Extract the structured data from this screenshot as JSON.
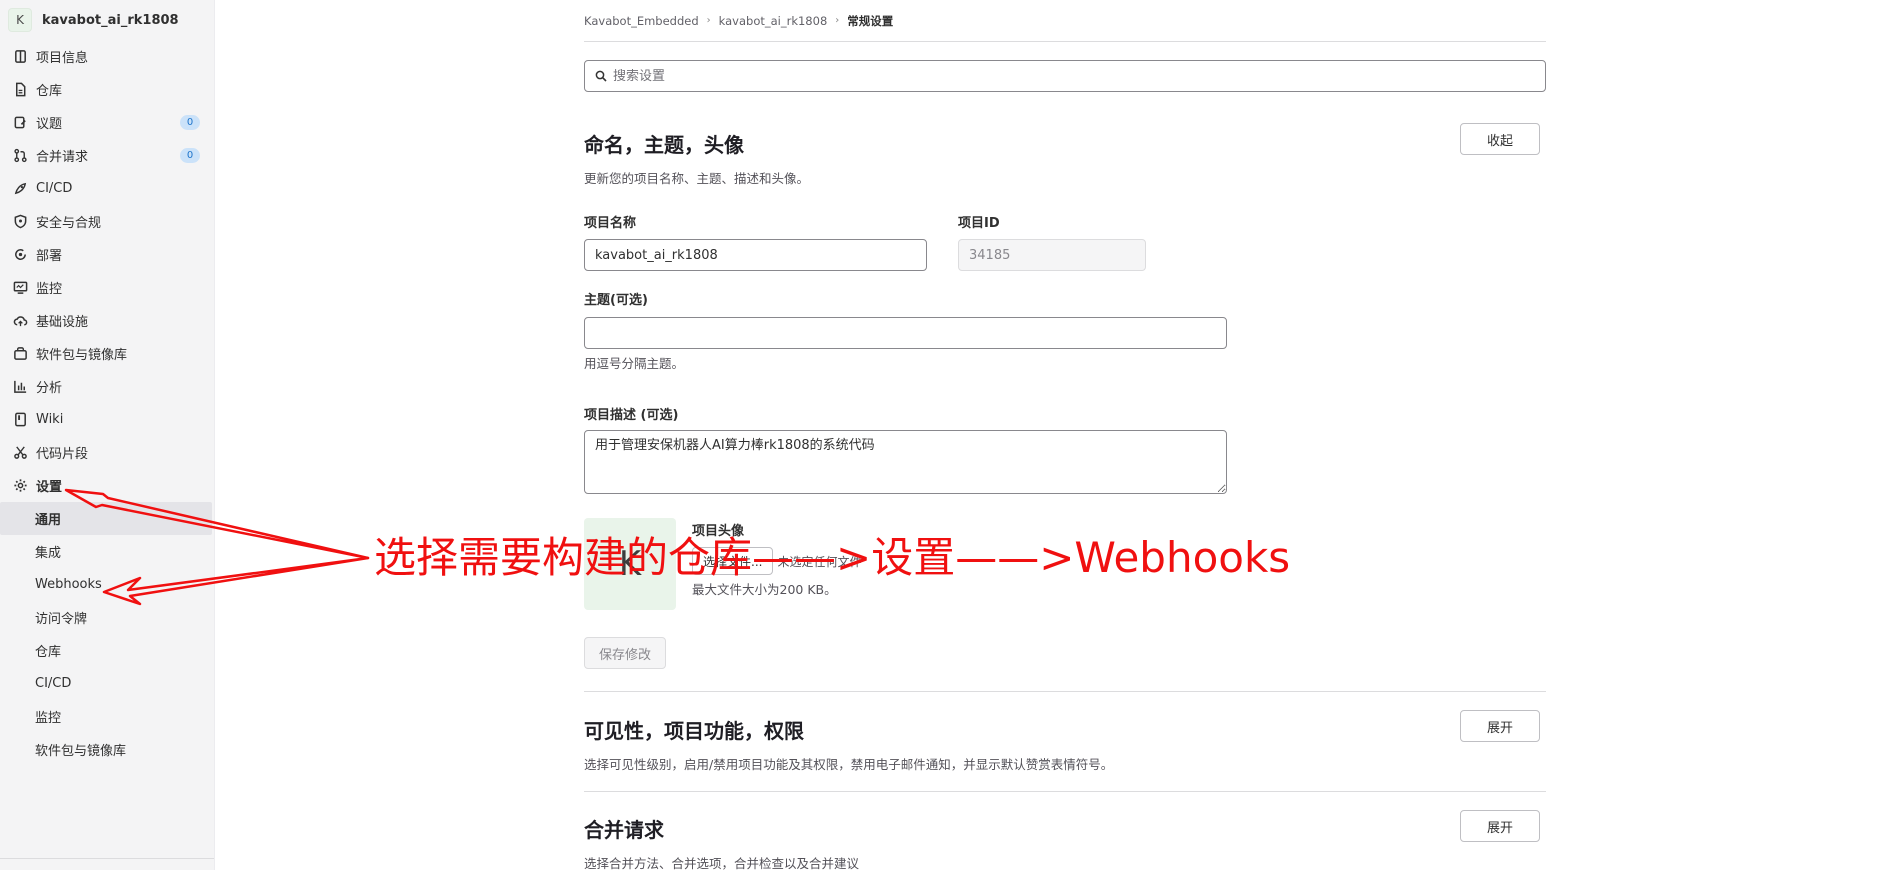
{
  "sidebar": {
    "project_initial": "K",
    "project_name": "kavabot_ai_rk1808",
    "items": [
      {
        "label": "项目信息",
        "icon": "project-icon"
      },
      {
        "label": "仓库",
        "icon": "doc-icon"
      },
      {
        "label": "议题",
        "icon": "issues-icon",
        "badge": "0"
      },
      {
        "label": "合并请求",
        "icon": "merge-request-icon",
        "badge": "0"
      },
      {
        "label": "CI/CD",
        "icon": "rocket-icon"
      },
      {
        "label": "安全与合规",
        "icon": "shield-icon"
      },
      {
        "label": "部署",
        "icon": "deploy-icon"
      },
      {
        "label": "监控",
        "icon": "monitor-icon"
      },
      {
        "label": "基础设施",
        "icon": "cloud-icon"
      },
      {
        "label": "软件包与镜像库",
        "icon": "package-icon"
      },
      {
        "label": "分析",
        "icon": "chart-icon"
      },
      {
        "label": "Wiki",
        "icon": "book-icon"
      },
      {
        "label": "代码片段",
        "icon": "scissors-icon"
      },
      {
        "label": "设置",
        "icon": "gear-icon"
      }
    ],
    "settings_sub": [
      "通用",
      "集成",
      "Webhooks",
      "访问令牌",
      "仓库",
      "CI/CD",
      "监控",
      "软件包与镜像库"
    ]
  },
  "breadcrumb": [
    "Kavabot_Embedded",
    "kavabot_ai_rk1808",
    "常规设置"
  ],
  "search": {
    "placeholder": "搜索设置"
  },
  "naming": {
    "title": "命名，主题，头像",
    "description": "更新您的项目名称、主题、描述和头像。",
    "collapse_label": "收起",
    "project_name_label": "项目名称",
    "project_name_value": "kavabot_ai_rk1808",
    "project_id_label": "项目ID",
    "project_id_value": "34185",
    "topics_label": "主题(可选)",
    "topics_value": "",
    "topics_help": "用逗号分隔主题。",
    "desc_label": "项目描述 (可选)",
    "desc_value": "用于管理安保机器人AI算力棒rk1808的系统代码",
    "avatar_label": "项目头像",
    "avatar_initial": "K",
    "choose_file": "选择文件...",
    "no_file": "未选定任何文件",
    "max_size": "最大文件大小为200 KB。",
    "save_label": "保存修改"
  },
  "visibility": {
    "title": "可见性，项目功能，权限",
    "description": "选择可见性级别，启用/禁用项目功能及其权限，禁用电子邮件通知，并显示默认赞赏表情符号。",
    "expand_label": "展开"
  },
  "merge": {
    "title": "合并请求",
    "description": "选择合并方法、合并选项，合并检查以及合并建议",
    "expand_label": "展开"
  },
  "annotation": {
    "text": "选择需要构建的仓库——>设置——>Webhooks",
    "color": "#f01010"
  }
}
